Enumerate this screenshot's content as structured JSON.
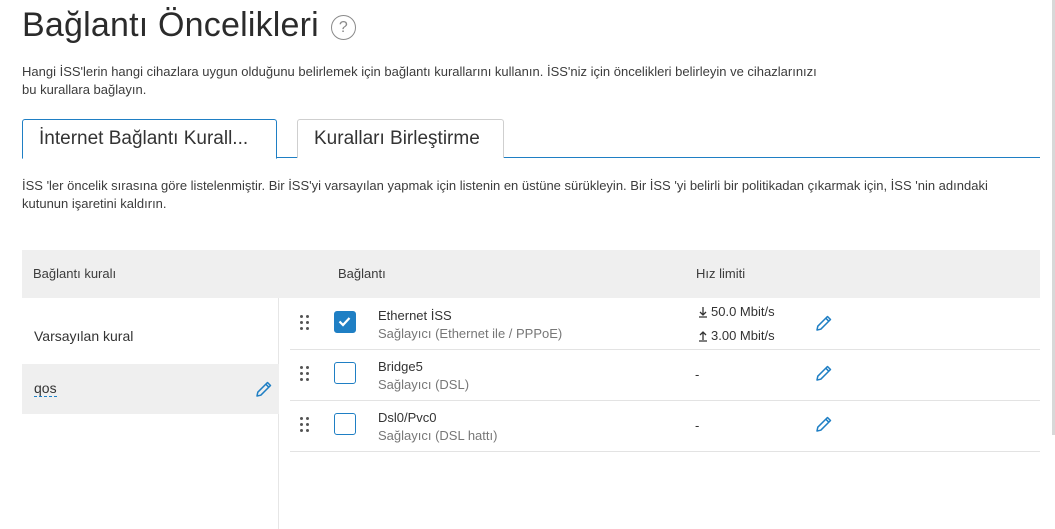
{
  "page": {
    "title": "Bağlantı Öncelikleri",
    "help_icon_text": "?",
    "intro": "Hangi İSS'lerin hangi cihazlara uygun olduğunu belirlemek için bağlantı kurallarını kullanın. İSS'niz için öncelikleri belirleyin ve cihazlarınızı bu kurallara bağlayın."
  },
  "tabs": [
    {
      "label": "İnternet Bağlantı Kurall...",
      "active": true
    },
    {
      "label": "Kuralları Birleştirme",
      "active": false
    }
  ],
  "description": "İSS 'ler öncelik sırasına göre listelenmiştir. Bir İSS'yi varsayılan yapmak için listenin en üstüne sürükleyin. Bir İSS 'yi belirli bir politikadan çıkarmak için, İSS 'nin adındaki kutunun işaretini kaldırın.",
  "table_headers": {
    "rule": "Bağlantı kuralı",
    "connection": "Bağlantı",
    "speed_limit": "Hız limiti"
  },
  "rules": [
    {
      "label": "Varsayılan kural",
      "selected": false,
      "editable": false
    },
    {
      "label": "qos",
      "selected": true,
      "editable": true
    }
  ],
  "connections": [
    {
      "name": "Ethernet İSS",
      "provider": "Sağlayıcı (Ethernet ile / PPPoE)",
      "checked": true,
      "download": "50.0 Mbit/s",
      "upload": "3.00 Mbit/s",
      "speed": null
    },
    {
      "name": "Bridge5",
      "provider": "Sağlayıcı (DSL)",
      "checked": false,
      "download": null,
      "upload": null,
      "speed": "-"
    },
    {
      "name": "Dsl0/Pvc0",
      "provider": "Sağlayıcı (DSL hattı)",
      "checked": false,
      "download": null,
      "upload": null,
      "speed": "-"
    }
  ],
  "colors": {
    "accent": "#1f7fc4",
    "header_bg": "#efefef"
  },
  "icons": {
    "edit": "pencil-icon",
    "drag": "drag-handle-icon",
    "download": "download-arrow-icon",
    "upload": "upload-arrow-icon",
    "help": "help-circle-icon"
  }
}
